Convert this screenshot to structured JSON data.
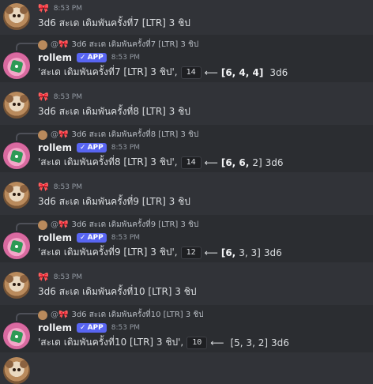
{
  "messages": [
    {
      "kind": "user",
      "time": "8:53 PM",
      "text": "3d6  สะเด เดิมพันครั้งที่7 [LTR] 3 ชิป"
    },
    {
      "kind": "bot",
      "reply_text": "3d6 สะเด เดิมพันครั้งที่7 [LTR] 3 ชิป",
      "name": "rollem",
      "badge": "APP",
      "time": "8:53 PM",
      "quote": "'สะเด เดิมพันครั้งที่7 [LTR] 3 ชิป',",
      "total": "14",
      "arrow": "⟵",
      "dice_bold": "[6, 4, 4]",
      "dice_rest": "",
      "suffix": "3d6"
    },
    {
      "kind": "user",
      "time": "8:53 PM",
      "text": "3d6  สะเด เดิมพันครั้งที่8 [LTR] 3 ชิป"
    },
    {
      "kind": "bot",
      "reply_text": "3d6 สะเด เดิมพันครั้งที่8 [LTR] 3 ชิป",
      "name": "rollem",
      "badge": "APP",
      "time": "8:53 PM",
      "quote": "'สะเด เดิมพันครั้งที่8 [LTR] 3 ชิป',",
      "total": "14",
      "arrow": "⟵",
      "dice_bold": "[6, 6,",
      "dice_rest": " 2]",
      "suffix": "3d6"
    },
    {
      "kind": "user",
      "time": "8:53 PM",
      "text": "3d6  สะเด เดิมพันครั้งที่9 [LTR] 3 ชิป"
    },
    {
      "kind": "bot",
      "reply_text": "3d6 สะเด เดิมพันครั้งที่9 [LTR] 3 ชิป",
      "name": "rollem",
      "badge": "APP",
      "time": "8:53 PM",
      "quote": "'สะเด เดิมพันครั้งที่9 [LTR] 3 ชิป',",
      "total": "12",
      "arrow": "⟵",
      "dice_bold": "[6,",
      "dice_rest": " 3, 3]",
      "suffix": "3d6"
    },
    {
      "kind": "user",
      "time": "8:53 PM",
      "text": "3d6  สะเด เดิมพันครั้งที่10 [LTR] 3 ชิป"
    },
    {
      "kind": "bot",
      "reply_text": "3d6 สะเด เดิมพันครั้งที่10 [LTR] 3 ชิป",
      "name": "rollem",
      "badge": "APP",
      "time": "8:53 PM",
      "quote": "'สะเด เดิมพันครั้งที่10 [LTR] 3 ชิป',",
      "total": "10",
      "arrow": "⟵",
      "dice_bold": "",
      "dice_rest": "[5, 3, 2]",
      "suffix": "3d6"
    }
  ],
  "icons": {
    "user_badge": "bow-icon",
    "bot_avatar": "dice-avatar",
    "user_avatar": "bear-avatar",
    "verified": "check-icon"
  },
  "colors": {
    "bg": "#313338",
    "bot_bg": "#2b2d31",
    "app_badge": "#5865f2",
    "bow": "#e23a5a"
  }
}
